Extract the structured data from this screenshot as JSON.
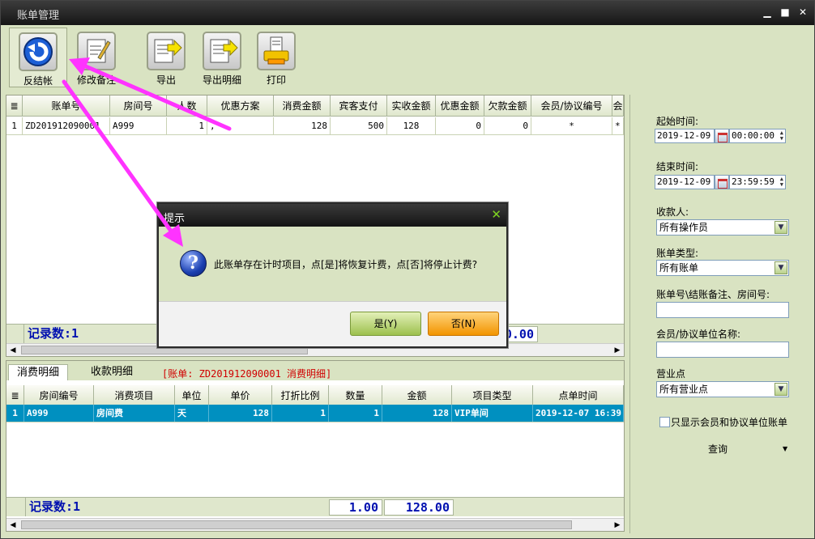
{
  "window": {
    "title": "账单管理",
    "controls": [
      "▁",
      "■",
      "✕"
    ]
  },
  "toolbar": {
    "buttons": [
      {
        "label": "反结帐",
        "icon": "undo-arrow-icon"
      },
      {
        "label": "修改备注",
        "icon": "notepad-edit-icon"
      },
      {
        "label": "导出",
        "icon": "export-document-icon"
      },
      {
        "label": "导出明细",
        "icon": "export-detail-icon"
      },
      {
        "label": "打印",
        "icon": "printer-icon"
      }
    ]
  },
  "bill_grid": {
    "headers": [
      "",
      "账单号",
      "房间号",
      "人数",
      "优惠方案",
      "消费金额",
      "宾客支付",
      "实收金额",
      "优惠金额",
      "欠款金额",
      "会员/协议编号",
      "会"
    ],
    "rows": [
      [
        "1",
        "ZD201912090001",
        "A999",
        "1",
        ",",
        "128",
        "500",
        "128",
        "0",
        "0",
        "*",
        "*"
      ]
    ],
    "record_count_label": "记录数:1",
    "sum_value": "0.00"
  },
  "detail_tabs": {
    "tabs": [
      "消费明细",
      "收款明细"
    ],
    "note": "[账单: ZD201912090001 消费明细]"
  },
  "detail_grid": {
    "headers": [
      "",
      "房间编号",
      "消费项目",
      "单位",
      "单价",
      "打折比例",
      "数量",
      "金额",
      "项目类型",
      "点单时间"
    ],
    "rows": [
      [
        "1",
        "A999",
        "房间费",
        "天",
        "128",
        "1",
        "1",
        "128",
        "VIP单间",
        "2019-12-07 16:39"
      ]
    ],
    "record_count_label": "记录数:1",
    "sum_qty": "1.00",
    "sum_amount": "128.00"
  },
  "filters": {
    "start_label": "起始时间:",
    "start_date": "2019-12-09",
    "start_time": "00:00:00",
    "end_label": "结束时间:",
    "end_date": "2019-12-09",
    "end_time": "23:59:59",
    "cashier_label": "收款人:",
    "cashier_value": "所有操作员",
    "bill_type_label": "账单类型:",
    "bill_type_value": "所有账单",
    "search_label": "账单号\\结账备注、房间号:",
    "member_label": "会员/协议单位名称:",
    "outlet_label": "营业点",
    "outlet_value": "所有营业点",
    "member_only_label": "只显示会员和协议单位账单",
    "query_label": "查询"
  },
  "dialog": {
    "title": "提示",
    "message": "此账单存在计时项目，点[是]将恢复计费，点[否]将停止计费?",
    "yes_label": "是(Y)",
    "no_label": "否(N)"
  },
  "colors": {
    "annotation_arrow": "#ff33ff",
    "selected_row": "#0090c0",
    "panel_bg": "#d9e3c2"
  }
}
